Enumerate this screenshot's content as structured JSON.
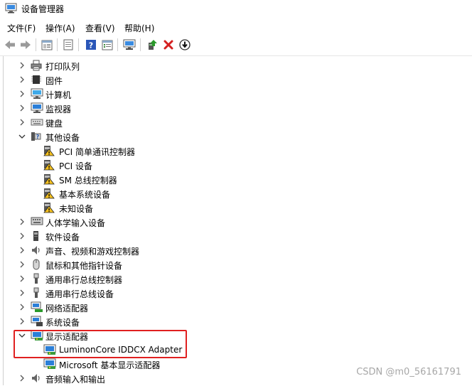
{
  "window": {
    "title": "设备管理器",
    "icon": "device-manager-icon"
  },
  "menubar": [
    {
      "label": "文件(F)"
    },
    {
      "label": "操作(A)"
    },
    {
      "label": "查看(V)"
    },
    {
      "label": "帮助(H)"
    }
  ],
  "toolbar": [
    {
      "name": "back-icon"
    },
    {
      "name": "forward-icon"
    },
    {
      "name": "properties-icon"
    },
    {
      "name": "console-icon"
    },
    {
      "name": "help-icon"
    },
    {
      "name": "view-icon"
    },
    {
      "name": "monitor-icon"
    },
    {
      "name": "update-driver-icon"
    },
    {
      "name": "uninstall-icon"
    },
    {
      "name": "scan-hardware-icon"
    }
  ],
  "tree": [
    {
      "label": "打印队列",
      "icon": "printer-icon",
      "expanded": false,
      "level": 0
    },
    {
      "label": "固件",
      "icon": "chip-icon",
      "expanded": false,
      "level": 0
    },
    {
      "label": "计算机",
      "icon": "computer-icon",
      "expanded": false,
      "level": 0
    },
    {
      "label": "监视器",
      "icon": "monitor-icon",
      "expanded": false,
      "level": 0
    },
    {
      "label": "键盘",
      "icon": "keyboard-icon",
      "expanded": false,
      "level": 0
    },
    {
      "label": "其他设备",
      "icon": "unknown-device-icon",
      "expanded": true,
      "level": 0
    },
    {
      "label": "PCI 简单通讯控制器",
      "icon": "warning-device-icon",
      "level": 1
    },
    {
      "label": "PCI 设备",
      "icon": "warning-device-icon",
      "level": 1
    },
    {
      "label": "SM 总线控制器",
      "icon": "warning-device-icon",
      "level": 1
    },
    {
      "label": "基本系统设备",
      "icon": "warning-device-icon",
      "level": 1
    },
    {
      "label": "未知设备",
      "icon": "warning-device-icon",
      "level": 1
    },
    {
      "label": "人体学输入设备",
      "icon": "hid-icon",
      "expanded": false,
      "level": 0
    },
    {
      "label": "软件设备",
      "icon": "software-device-icon",
      "expanded": false,
      "level": 0
    },
    {
      "label": "声音、视频和游戏控制器",
      "icon": "speaker-icon",
      "expanded": false,
      "level": 0
    },
    {
      "label": "鼠标和其他指针设备",
      "icon": "mouse-icon",
      "expanded": false,
      "level": 0
    },
    {
      "label": "通用串行总线控制器",
      "icon": "usb-icon",
      "expanded": false,
      "level": 0
    },
    {
      "label": "通用串行总线设备",
      "icon": "usb-icon",
      "expanded": false,
      "level": 0
    },
    {
      "label": "网络适配器",
      "icon": "network-icon",
      "expanded": false,
      "level": 0
    },
    {
      "label": "系统设备",
      "icon": "system-device-icon",
      "expanded": false,
      "level": 0
    },
    {
      "label": "显示适配器",
      "icon": "display-adapter-icon",
      "expanded": true,
      "level": 0
    },
    {
      "label": "LuminonCore IDDCX Adapter",
      "icon": "display-adapter-icon",
      "level": 1
    },
    {
      "label": "Microsoft 基本显示适配器",
      "icon": "display-adapter-icon",
      "level": 1
    },
    {
      "label": "音频输入和输出",
      "icon": "speaker-icon",
      "expanded": false,
      "level": 0
    }
  ],
  "watermark": "CSDN @m0_56161791",
  "colors": {
    "highlight": "#e02020",
    "monitor": "#2b7fd8"
  }
}
